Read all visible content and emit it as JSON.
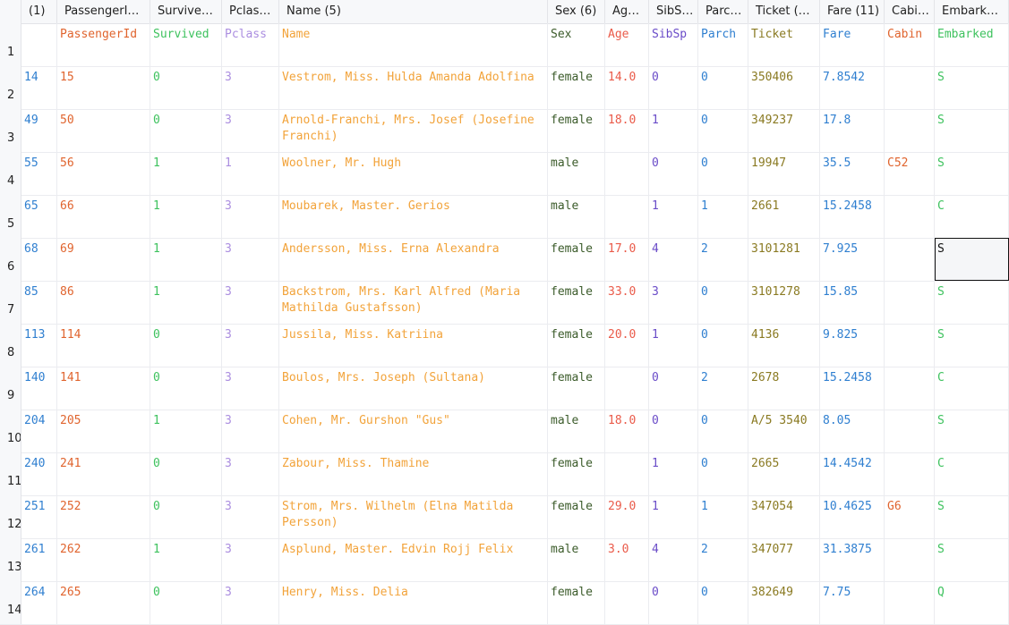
{
  "headers": [
    "(1)",
    "PassengerI…",
    "Survive…",
    "Pclas…",
    "Name (5)",
    "Sex (6)",
    "Ag…",
    "SibS…",
    "Parc…",
    "Ticket (…",
    "Fare (11)",
    "Cabi…",
    "Embark…"
  ],
  "column_colors": [
    "#2f7fd0",
    "#e0642e",
    "#3ec25e",
    "#ab8ee0",
    "#f2a33a",
    "#3b5b2a",
    "#ea5b4a",
    "#6a4cc8",
    "#2f7fd0",
    "#8a7a22",
    "#2f7fd0",
    "#e0642e",
    "#3ec25e"
  ],
  "rows": [
    {
      "num": "1",
      "cells": [
        "",
        "PassengerId",
        "Survived",
        "Pclass",
        "Name",
        "Sex",
        "Age",
        "SibSp",
        "Parch",
        "Ticket",
        "Fare",
        "Cabin",
        "Embarked"
      ]
    },
    {
      "num": "2",
      "cells": [
        "14",
        "15",
        "0",
        "3",
        "Vestrom, Miss. Hulda Amanda Adolfina",
        "female",
        "14.0",
        "0",
        "0",
        "350406",
        "7.8542",
        "",
        "S"
      ]
    },
    {
      "num": "3",
      "cells": [
        "49",
        "50",
        "0",
        "3",
        "Arnold-Franchi, Mrs. Josef (Josefine Franchi)",
        "female",
        "18.0",
        "1",
        "0",
        "349237",
        "17.8",
        "",
        "S"
      ]
    },
    {
      "num": "4",
      "cells": [
        "55",
        "56",
        "1",
        "1",
        "Woolner, Mr. Hugh",
        "male",
        "",
        "0",
        "0",
        "19947",
        "35.5",
        "C52",
        "S"
      ]
    },
    {
      "num": "5",
      "cells": [
        "65",
        "66",
        "1",
        "3",
        "Moubarek, Master. Gerios",
        "male",
        "",
        "1",
        "1",
        "2661",
        "15.2458",
        "",
        "C"
      ]
    },
    {
      "num": "6",
      "cells": [
        "68",
        "69",
        "1",
        "3",
        "Andersson, Miss. Erna Alexandra",
        "female",
        "17.0",
        "4",
        "2",
        "3101281",
        "7.925",
        "",
        "S"
      ]
    },
    {
      "num": "7",
      "cells": [
        "85",
        "86",
        "1",
        "3",
        "Backstrom, Mrs. Karl Alfred (Maria Mathilda Gustafsson)",
        "female",
        "33.0",
        "3",
        "0",
        "3101278",
        "15.85",
        "",
        "S"
      ]
    },
    {
      "num": "8",
      "cells": [
        "113",
        "114",
        "0",
        "3",
        "Jussila, Miss. Katriina",
        "female",
        "20.0",
        "1",
        "0",
        "4136",
        "9.825",
        "",
        "S"
      ]
    },
    {
      "num": "9",
      "cells": [
        "140",
        "141",
        "0",
        "3",
        "Boulos, Mrs. Joseph (Sultana)",
        "female",
        "",
        "0",
        "2",
        "2678",
        "15.2458",
        "",
        "C"
      ]
    },
    {
      "num": "10",
      "cells": [
        "204",
        "205",
        "1",
        "3",
        "Cohen, Mr. Gurshon \"Gus\"",
        "male",
        "18.0",
        "0",
        "0",
        "A/5 3540",
        "8.05",
        "",
        "S"
      ]
    },
    {
      "num": "11",
      "cells": [
        "240",
        "241",
        "0",
        "3",
        "Zabour, Miss. Thamine",
        "female",
        "",
        "1",
        "0",
        "2665",
        "14.4542",
        "",
        "C"
      ]
    },
    {
      "num": "12",
      "cells": [
        "251",
        "252",
        "0",
        "3",
        "Strom, Mrs. Wilhelm (Elna Matilda Persson)",
        "female",
        "29.0",
        "1",
        "1",
        "347054",
        "10.4625",
        "G6",
        "S"
      ]
    },
    {
      "num": "13",
      "cells": [
        "261",
        "262",
        "1",
        "3",
        "Asplund, Master. Edvin Rojj Felix",
        "male",
        "3.0",
        "4",
        "2",
        "347077",
        "31.3875",
        "",
        "S"
      ]
    },
    {
      "num": "14",
      "cells": [
        "264",
        "265",
        "0",
        "3",
        "Henry, Miss. Delia",
        "female",
        "",
        "0",
        "0",
        "382649",
        "7.75",
        "",
        "Q"
      ]
    }
  ],
  "selected_cell": {
    "row": "6",
    "column": "Embark…",
    "value": "S"
  }
}
